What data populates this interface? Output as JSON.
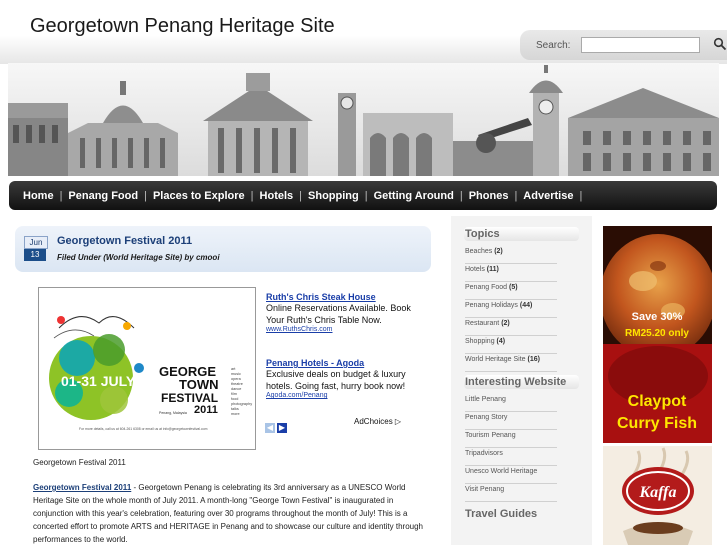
{
  "header": {
    "title": "Georgetown Penang Heritage Site",
    "search_label": "Search:",
    "search_value": ""
  },
  "nav": {
    "items": [
      "Home",
      "Penang Food",
      "Places to Explore",
      "Hotels",
      "Shopping",
      "Getting Around",
      "Phones",
      "Advertise"
    ]
  },
  "post": {
    "month": "Jun",
    "day": "13",
    "title": "Georgetown Festival 2011",
    "meta": "Filed Under (World Heritage Site) by cmooi",
    "poster": {
      "date_text": "01-31 JULY",
      "festival_line1": "GEORGE",
      "festival_line2": "TOWN",
      "festival_line3": "FESTIVAL",
      "festival_year": "2011",
      "location": "Penang, Malaysia",
      "categories": [
        "art",
        "music",
        "opera",
        "theatre",
        "dance",
        "film",
        "food",
        "photography",
        "talks",
        "more"
      ],
      "contact": "For more details, call us at 604-261 6308 or email us at info@georgetownfestival.com"
    },
    "caption": "Georgetown Festival 2011",
    "body_lead": "Georgetown Festival 2011",
    "body_text": " - Georgetown Penang is celebrating its 3rd anniversary as a UNESCO World Heritage Site on the whole month of July 2011.  A month-long \"George Town Festival\" is inaugurated in conjunction with this year's celebration, featuring over 30 programs throughout the month of July! This is a concerted effort to promote ARTS and HERITAGE in Penang and to showcase our culture and identity through performances to the world."
  },
  "ads": [
    {
      "title": "Ruth's Chris Steak House",
      "text": "Online Reservations Available. Book Your Ruth's Chris Table Now.",
      "url": "www.RuthsChris.com"
    },
    {
      "title": "Penang Hotels - Agoda",
      "text": "Exclusive deals on budget & luxury hotels. Going fast, hurry book now!",
      "url": "Agoda.com/Penang"
    }
  ],
  "adchoices": "AdChoices",
  "sidebar": {
    "topics_heading": "Topics",
    "topics": [
      {
        "label": "Beaches",
        "count": "(2)"
      },
      {
        "label": "Hotels",
        "count": "(11)"
      },
      {
        "label": "Penang Food",
        "count": "(5)"
      },
      {
        "label": "Penang Holidays",
        "count": "(44)"
      },
      {
        "label": "Restaurant",
        "count": "(2)"
      },
      {
        "label": "Shopping",
        "count": "(4)"
      },
      {
        "label": "World Heritage Site",
        "count": "(16)"
      }
    ],
    "interesting_heading": "Interesting Website",
    "interesting": [
      "Little Penang",
      "Penang Story",
      "Tourism Penang",
      "Tripadvisors",
      "Unesco World Heritage",
      "Visit Penang"
    ],
    "travel_heading": "Travel Guides"
  },
  "side_ads": {
    "claypot_save": "Save 30%",
    "claypot_price": "RM25.20 only",
    "claypot_line1": "Claypot",
    "claypot_line2": "Curry Fish",
    "kaffa": "Kaffa"
  },
  "colors": {
    "nav_bg": "#1a1a1a",
    "link_blue": "#1a3ea8",
    "title_blue": "#1c3f78",
    "date_blue": "#1c4e8a"
  }
}
